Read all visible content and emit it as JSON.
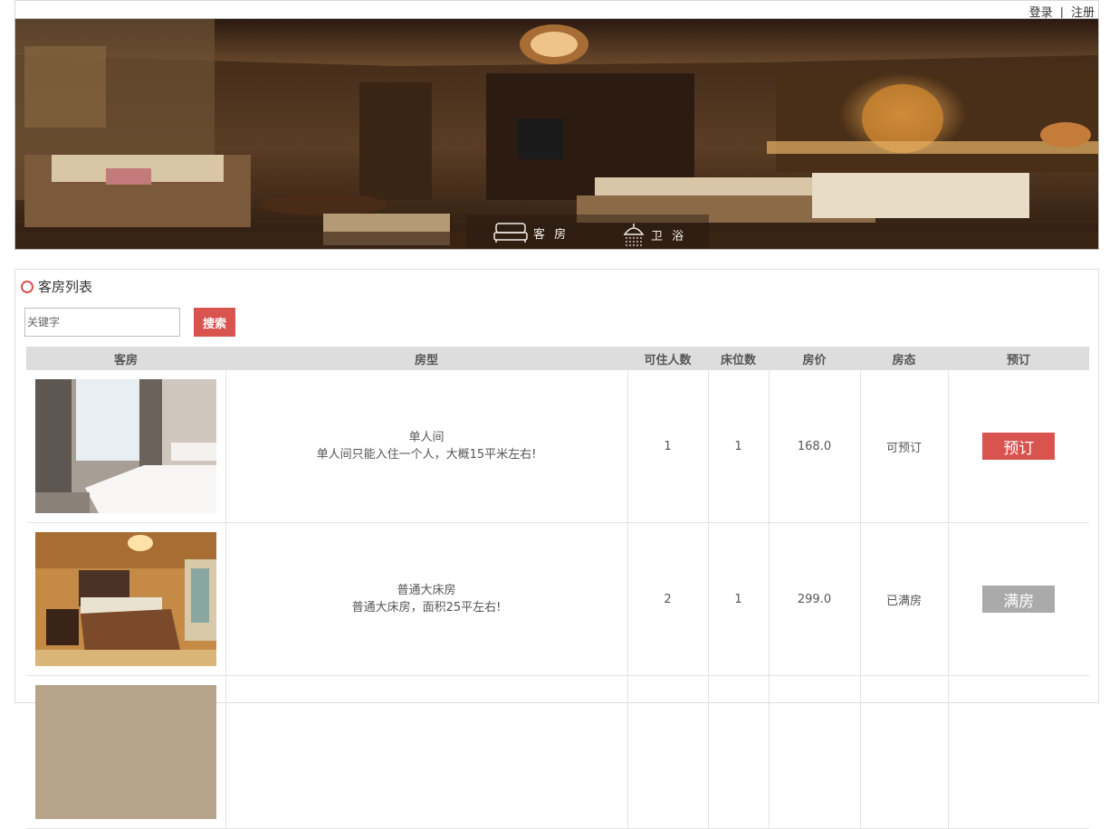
{
  "header": {
    "login": "登录",
    "separator": "|",
    "register": "注册"
  },
  "banner": {
    "nav": [
      {
        "label": "客 房",
        "icon": "bed-icon"
      },
      {
        "label": "卫 浴",
        "icon": "shower-icon"
      }
    ]
  },
  "section": {
    "title": "客房列表"
  },
  "search": {
    "placeholder": "关键字",
    "button": "搜索"
  },
  "table": {
    "headers": [
      "客房",
      "房型",
      "可住人数",
      "床位数",
      "房价",
      "房态",
      "预订"
    ],
    "rows": [
      {
        "type_name": "单人间",
        "type_desc": "单人间只能入住一个人，大概15平米左右!",
        "capacity": "1",
        "beds": "1",
        "price": "168.0",
        "status": "可预订",
        "action": "预订"
      },
      {
        "type_name": "普通大床房",
        "type_desc": "普通大床房，面积25平左右!",
        "capacity": "2",
        "beds": "1",
        "price": "299.0",
        "status": "已满房",
        "action": "满房"
      }
    ]
  },
  "colors": {
    "accent": "#d9534f",
    "disabled": "#aaaaaa",
    "header_bg": "#dddddd"
  }
}
